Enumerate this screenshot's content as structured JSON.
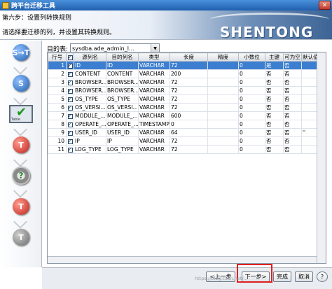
{
  "window": {
    "title": "跨平台迁移工具"
  },
  "header": {
    "step": "第六步：设置列转换规则",
    "instruction": "请选择要迁移的列，并设置其转换规则。",
    "brand": "SHENTONG"
  },
  "sidebar": {
    "items": [
      {
        "icon": "source-target-icon",
        "text": "S→T"
      },
      {
        "icon": "source-connect-icon",
        "text": "S"
      },
      {
        "icon": "table-check-icon",
        "text": "Table"
      },
      {
        "icon": "target-connect-icon",
        "text": "T"
      },
      {
        "icon": "gear-question-icon",
        "text": "?"
      },
      {
        "icon": "gear-target-icon",
        "text": "T"
      },
      {
        "icon": "target-report-icon",
        "text": "T"
      }
    ]
  },
  "target_table": {
    "label": "目的表:",
    "value": "sysdba.ade_admin_l..."
  },
  "grid": {
    "columns": [
      "行号",
      "",
      "源列名",
      "目的列名",
      "类型",
      "长度",
      "精度",
      "小数位",
      "主键",
      "可为空",
      "默认值"
    ],
    "rows": [
      {
        "no": "1",
        "src": "ID",
        "dst": "ID",
        "type": "VARCHAR",
        "len": "72",
        "prec": "",
        "scale": "0",
        "pk": "是",
        "nullable": "否",
        "def": "",
        "selected": true
      },
      {
        "no": "2",
        "src": "CONTENT",
        "dst": "CONTENT",
        "type": "VARCHAR",
        "len": "200",
        "prec": "",
        "scale": "0",
        "pk": "否",
        "nullable": "否",
        "def": "",
        "selected": false
      },
      {
        "no": "3",
        "src": "BROWSER...",
        "dst": "BROWSER...",
        "type": "VARCHAR",
        "len": "72",
        "prec": "",
        "scale": "0",
        "pk": "否",
        "nullable": "否",
        "def": "",
        "selected": false
      },
      {
        "no": "4",
        "src": "BROWSER...",
        "dst": "BROWSER...",
        "type": "VARCHAR",
        "len": "72",
        "prec": "",
        "scale": "0",
        "pk": "否",
        "nullable": "否",
        "def": "",
        "selected": false
      },
      {
        "no": "5",
        "src": "OS_TYPE",
        "dst": "OS_TYPE",
        "type": "VARCHAR",
        "len": "72",
        "prec": "",
        "scale": "0",
        "pk": "否",
        "nullable": "否",
        "def": "",
        "selected": false
      },
      {
        "no": "6",
        "src": "OS_VERSI...",
        "dst": "OS_VERSI...",
        "type": "VARCHAR",
        "len": "72",
        "prec": "",
        "scale": "0",
        "pk": "否",
        "nullable": "否",
        "def": "",
        "selected": false
      },
      {
        "no": "7",
        "src": "MODULE_...",
        "dst": "MODULE_...",
        "type": "VARCHAR",
        "len": "600",
        "prec": "",
        "scale": "0",
        "pk": "否",
        "nullable": "否",
        "def": "",
        "selected": false
      },
      {
        "no": "8",
        "src": "OPERATE_...",
        "dst": "OPERATE_...",
        "type": "TIMESTAMP",
        "len": "0",
        "prec": "",
        "scale": "0",
        "pk": "否",
        "nullable": "否",
        "def": "",
        "selected": false
      },
      {
        "no": "9",
        "src": "USER_ID",
        "dst": "USER_ID",
        "type": "VARCHAR",
        "len": "64",
        "prec": "",
        "scale": "0",
        "pk": "否",
        "nullable": "否",
        "def": "''",
        "selected": false
      },
      {
        "no": "10",
        "src": "IP",
        "dst": "IP",
        "type": "VARCHAR",
        "len": "72",
        "prec": "",
        "scale": "0",
        "pk": "否",
        "nullable": "否",
        "def": "",
        "selected": false
      },
      {
        "no": "11",
        "src": "LOG_TYPE",
        "dst": "LOG_TYPE",
        "type": "VARCHAR",
        "len": "72",
        "prec": "",
        "scale": "0",
        "pk": "否",
        "nullable": "否",
        "def": "",
        "selected": false
      }
    ]
  },
  "buttons": {
    "prev": "<上一步",
    "next": "下一步>",
    "finish": "完成",
    "cancel": "取消",
    "help": "?"
  },
  "watermark": "https://blog.csdn.net/..."
}
